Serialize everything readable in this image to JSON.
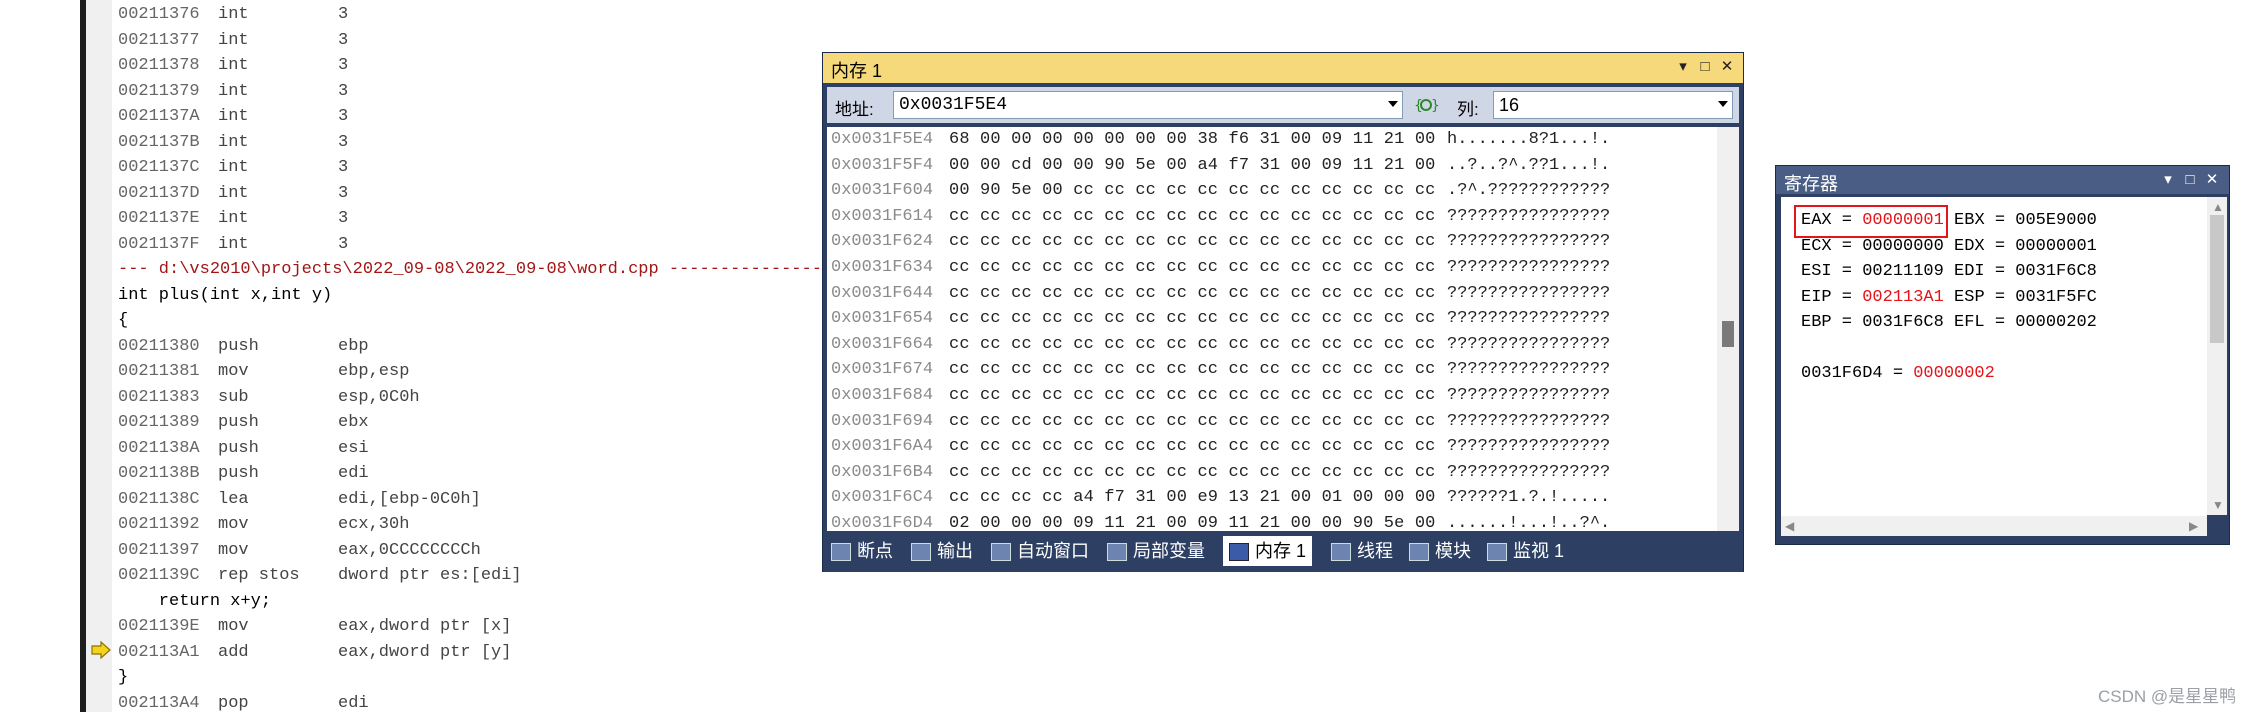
{
  "disasm": {
    "lines": [
      {
        "type": "asm",
        "addr": "00211376",
        "mn": "int",
        "op": "3"
      },
      {
        "type": "asm",
        "addr": "00211377",
        "mn": "int",
        "op": "3"
      },
      {
        "type": "asm",
        "addr": "00211378",
        "mn": "int",
        "op": "3"
      },
      {
        "type": "asm",
        "addr": "00211379",
        "mn": "int",
        "op": "3"
      },
      {
        "type": "asm",
        "addr": "0021137A",
        "mn": "int",
        "op": "3"
      },
      {
        "type": "asm",
        "addr": "0021137B",
        "mn": "int",
        "op": "3"
      },
      {
        "type": "asm",
        "addr": "0021137C",
        "mn": "int",
        "op": "3"
      },
      {
        "type": "asm",
        "addr": "0021137D",
        "mn": "int",
        "op": "3"
      },
      {
        "type": "asm",
        "addr": "0021137E",
        "mn": "int",
        "op": "3"
      },
      {
        "type": "asm",
        "addr": "0021137F",
        "mn": "int",
        "op": "3"
      },
      {
        "type": "file",
        "text": "--- d:\\vs2010\\projects\\2022_09-08\\2022_09-08\\word.cpp ---------------------"
      },
      {
        "type": "src",
        "text": "int plus(int x,int y)"
      },
      {
        "type": "src",
        "text": "{"
      },
      {
        "type": "asm",
        "addr": "00211380",
        "mn": "push",
        "op": "ebp"
      },
      {
        "type": "asm",
        "addr": "00211381",
        "mn": "mov",
        "op": "ebp,esp"
      },
      {
        "type": "asm",
        "addr": "00211383",
        "mn": "sub",
        "op": "esp,0C0h"
      },
      {
        "type": "asm",
        "addr": "00211389",
        "mn": "push",
        "op": "ebx"
      },
      {
        "type": "asm",
        "addr": "0021138A",
        "mn": "push",
        "op": "esi"
      },
      {
        "type": "asm",
        "addr": "0021138B",
        "mn": "push",
        "op": "edi"
      },
      {
        "type": "asm",
        "addr": "0021138C",
        "mn": "lea",
        "op": "edi,[ebp-0C0h]"
      },
      {
        "type": "asm",
        "addr": "00211392",
        "mn": "mov",
        "op": "ecx,30h"
      },
      {
        "type": "asm",
        "addr": "00211397",
        "mn": "mov",
        "op": "eax,0CCCCCCCCh"
      },
      {
        "type": "asm",
        "addr": "0021139C",
        "mn": "rep stos",
        "op": "dword ptr es:[edi]"
      },
      {
        "type": "src",
        "text": "    return x+y;"
      },
      {
        "type": "asm",
        "addr": "0021139E",
        "mn": "mov",
        "op": "eax,dword ptr [x]"
      },
      {
        "type": "asm",
        "addr": "002113A1",
        "mn": "add",
        "op": "eax,dword ptr [y]"
      },
      {
        "type": "src",
        "text": "}"
      },
      {
        "type": "asm",
        "addr": "002113A4",
        "mn": "pop",
        "op": "edi"
      }
    ]
  },
  "memory": {
    "title": "内存 1",
    "address_label": "地址:",
    "address_value": "0x0031F5E4",
    "columns_label": "列:",
    "columns_value": "16",
    "rows": [
      {
        "addr": "0x0031F5E4",
        "hex": "68 00 00 00 00 00 00 00 38 f6 31 00 09 11 21 00",
        "chars": "h.......8?1...!."
      },
      {
        "addr": "0x0031F5F4",
        "hex": "00 00 cd 00 00 90 5e 00 a4 f7 31 00 09 11 21 00",
        "chars": "..?..?^.??1...!."
      },
      {
        "addr": "0x0031F604",
        "hex": "00 90 5e 00 cc cc cc cc cc cc cc cc cc cc cc cc",
        "chars": ".?^.????????????"
      },
      {
        "addr": "0x0031F614",
        "hex": "cc cc cc cc cc cc cc cc cc cc cc cc cc cc cc cc",
        "chars": "????????????????"
      },
      {
        "addr": "0x0031F624",
        "hex": "cc cc cc cc cc cc cc cc cc cc cc cc cc cc cc cc",
        "chars": "????????????????"
      },
      {
        "addr": "0x0031F634",
        "hex": "cc cc cc cc cc cc cc cc cc cc cc cc cc cc cc cc",
        "chars": "????????????????"
      },
      {
        "addr": "0x0031F644",
        "hex": "cc cc cc cc cc cc cc cc cc cc cc cc cc cc cc cc",
        "chars": "????????????????"
      },
      {
        "addr": "0x0031F654",
        "hex": "cc cc cc cc cc cc cc cc cc cc cc cc cc cc cc cc",
        "chars": "????????????????"
      },
      {
        "addr": "0x0031F664",
        "hex": "cc cc cc cc cc cc cc cc cc cc cc cc cc cc cc cc",
        "chars": "????????????????"
      },
      {
        "addr": "0x0031F674",
        "hex": "cc cc cc cc cc cc cc cc cc cc cc cc cc cc cc cc",
        "chars": "????????????????"
      },
      {
        "addr": "0x0031F684",
        "hex": "cc cc cc cc cc cc cc cc cc cc cc cc cc cc cc cc",
        "chars": "????????????????"
      },
      {
        "addr": "0x0031F694",
        "hex": "cc cc cc cc cc cc cc cc cc cc cc cc cc cc cc cc",
        "chars": "????????????????"
      },
      {
        "addr": "0x0031F6A4",
        "hex": "cc cc cc cc cc cc cc cc cc cc cc cc cc cc cc cc",
        "chars": "????????????????"
      },
      {
        "addr": "0x0031F6B4",
        "hex": "cc cc cc cc cc cc cc cc cc cc cc cc cc cc cc cc",
        "chars": "????????????????"
      },
      {
        "addr": "0x0031F6C4",
        "hex": "cc cc cc cc a4 f7 31 00 e9 13 21 00 01 00 00 00",
        "chars": "??????1.?.!....."
      },
      {
        "addr": "0x0031F6D4",
        "hex": "02 00 00 00 09 11 21 00 09 11 21 00 00 90 5e 00",
        "chars": "......!...!..?^."
      }
    ],
    "tabs": [
      {
        "label": "断点",
        "icon": "breakpoint-icon"
      },
      {
        "label": "输出",
        "icon": "output-icon"
      },
      {
        "label": "自动窗口",
        "icon": "autos-icon"
      },
      {
        "label": "局部变量",
        "icon": "locals-icon"
      },
      {
        "label": "内存 1",
        "icon": "memory-icon",
        "active": true
      },
      {
        "label": "线程",
        "icon": "threads-icon"
      },
      {
        "label": "模块",
        "icon": "modules-icon"
      },
      {
        "label": "监视 1",
        "icon": "watch-icon"
      }
    ]
  },
  "registers": {
    "title": "寄存器",
    "lines": [
      {
        "parts": [
          {
            "t": "EAX = ",
            "red": false
          },
          {
            "t": "00000001",
            "red": true
          },
          {
            "t": " EBX = 005E9000",
            "red": false
          }
        ]
      },
      {
        "parts": [
          {
            "t": "ECX = 00000000 EDX = 00000001",
            "red": false
          }
        ]
      },
      {
        "parts": [
          {
            "t": "ESI = 00211109 EDI = 0031F6C8",
            "red": false
          }
        ]
      },
      {
        "parts": [
          {
            "t": "EIP = ",
            "red": false
          },
          {
            "t": "002113A1",
            "red": true
          },
          {
            "t": " ESP = 0031F5FC",
            "red": false
          }
        ]
      },
      {
        "parts": [
          {
            "t": "EBP = 0031F6C8 EFL = 00000202",
            "red": false
          }
        ]
      },
      {
        "parts": []
      },
      {
        "parts": [
          {
            "t": "0031F6D4 = ",
            "red": false
          },
          {
            "t": "00000002",
            "red": true
          }
        ]
      }
    ]
  },
  "watermark": "CSDN @是星星鸭",
  "colors": {
    "accent_red": "#e3141a",
    "panel": "#2d3f63",
    "active_title": "#f5d97b"
  }
}
